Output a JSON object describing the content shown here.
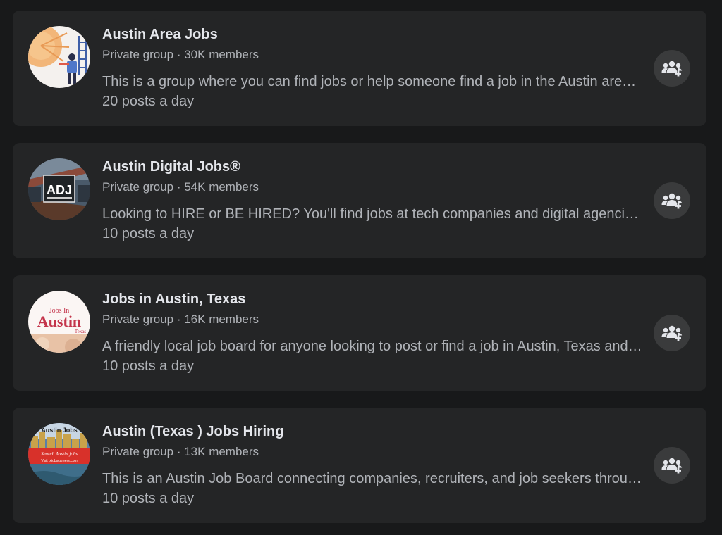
{
  "groups": [
    {
      "name": "Austin Area Jobs",
      "meta": "Private group · 30K members",
      "description": "This is a group where you can find jobs or help someone find a job in the Austin area, whether you are looking to hire or be hired.",
      "activity": "20 posts a day"
    },
    {
      "name": "Austin Digital Jobs®",
      "meta": "Private group · 54K members",
      "description": "Looking to HIRE or BE HIRED? You'll find jobs at tech companies and digital agencies across Austin here.",
      "activity": "10 posts a day",
      "avatar_text": "ADJ"
    },
    {
      "name": "Jobs in Austin, Texas",
      "meta": "Private group · 16K members",
      "description": "A friendly local job board for anyone looking to post or find a job in Austin, Texas and surrounding areas.",
      "activity": "10 posts a day",
      "avatar_text_top": "Jobs In",
      "avatar_text_main": "Austin",
      "avatar_text_sub": "Texas"
    },
    {
      "name": "Austin (Texas ) Jobs Hiring",
      "meta": "Private group · 13K members",
      "description": "This is an Austin Job Board connecting companies, recruiters, and job seekers throughout Central Texas.",
      "activity": "10 posts a day",
      "avatar_text_top": "Austin Jobs",
      "avatar_text_mid": "Search Austin jobs",
      "avatar_text_bot": "Visit txjobscareers.com"
    }
  ],
  "join_icon": "group-join-icon",
  "colors": {
    "background": "#18191a",
    "card": "#242526",
    "button": "#3a3b3c",
    "primary_text": "#e4e6eb",
    "secondary_text": "#b0b3b8"
  }
}
